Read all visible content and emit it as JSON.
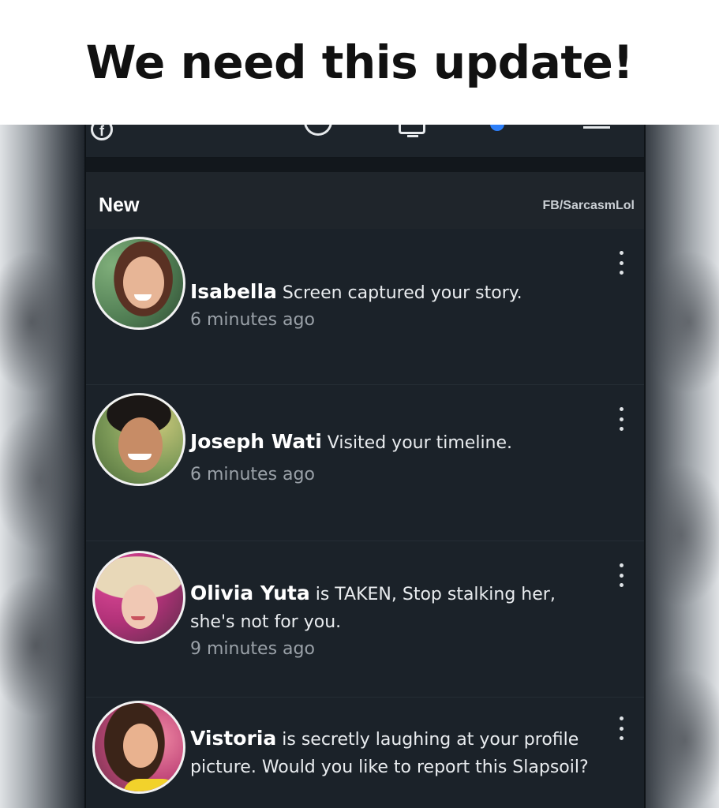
{
  "meme": {
    "title": "We need this update!"
  },
  "app": {
    "section_title": "New",
    "watermark": "FB/SarcasmLol"
  },
  "top_icons": [
    "facebook-icon",
    "messenger-icon",
    "watch-icon",
    "notifications-icon",
    "menu-icon"
  ],
  "notifications": [
    {
      "name": "Isabella",
      "message": "Screen captured your story.",
      "time": "6 minutes ago"
    },
    {
      "name": "Joseph Wati",
      "message": "Visited your timeline.",
      "time": "6 minutes ago"
    },
    {
      "name": "Olivia Yuta",
      "message": "is TAKEN, Stop stalking her, she's not for you.",
      "time": "9 minutes ago"
    },
    {
      "name": "Vistoria",
      "message": "is secretly laughing at your profile picture. Would you like to report this Slapsoil?",
      "time": ""
    }
  ],
  "colors": {
    "app_background": "#1b2229",
    "accent": "#2d7ff9"
  }
}
